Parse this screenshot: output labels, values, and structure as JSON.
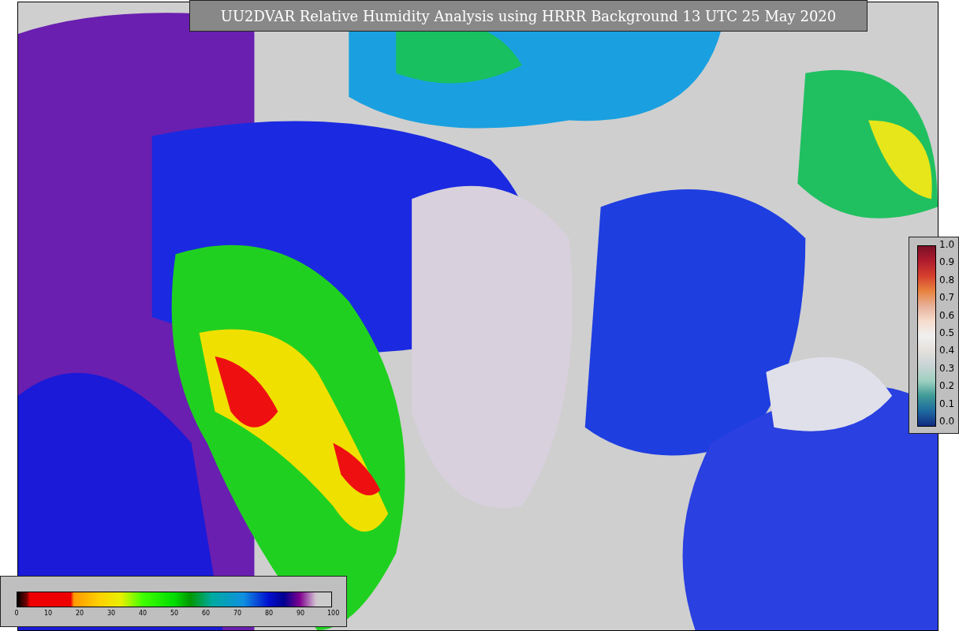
{
  "title": "UU2DVAR Relative Humidity Analysis using HRRR Background 13 UTC 25 May 2020",
  "side_colorbar": {
    "ticks": [
      "1.0",
      "0.9",
      "0.8",
      "0.7",
      "0.6",
      "0.5",
      "0.4",
      "0.3",
      "0.2",
      "0.1",
      "0.0"
    ]
  },
  "bottom_colorbar": {
    "ticks": [
      "0",
      "10",
      "20",
      "30",
      "40",
      "50",
      "60",
      "70",
      "80",
      "90",
      "100"
    ]
  }
}
